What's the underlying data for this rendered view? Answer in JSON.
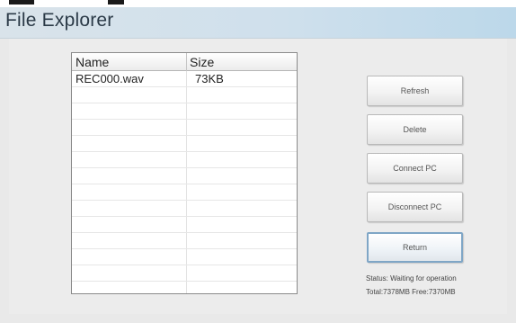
{
  "window": {
    "title": "File Explorer"
  },
  "file_list": {
    "columns": [
      "Name",
      "Size"
    ],
    "rows": [
      {
        "name": "REC000.wav",
        "size": "73KB"
      }
    ]
  },
  "buttons": {
    "refresh": "Refresh",
    "delete": "Delete",
    "connect_pc": "Connect PC",
    "disconnect_pc": "Disconnect PC",
    "return": "Return"
  },
  "status": {
    "line1": "Status: Waiting for operation",
    "line2": "Total:7378MB Free:7370MB"
  }
}
